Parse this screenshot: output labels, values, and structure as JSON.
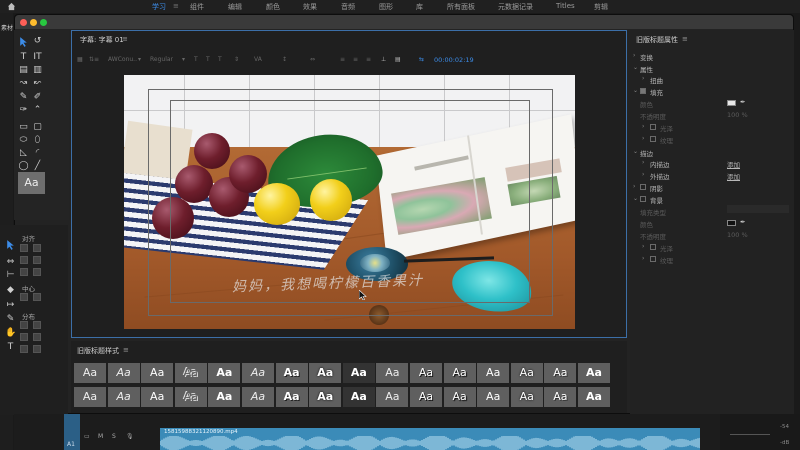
{
  "top_menu": {
    "items": [
      "学习",
      "组件",
      "编辑",
      "颜色",
      "效果",
      "音频",
      "图形",
      "库",
      "所有面板",
      "元数据记录",
      "Titles",
      "剪辑"
    ],
    "active": "学习"
  },
  "app_rail_label": "素材",
  "title_panel": {
    "tab_title": "字幕: 字幕 01",
    "toolbar": {
      "font_family": "AWConu..",
      "font_style": "Regular",
      "timecode": "00:00:02:19"
    },
    "caption_text": "妈妈，我想喝柠檬百香果汁"
  },
  "align_panel": {
    "title": "对齐",
    "center_label": "中心",
    "distribute_label": "分布"
  },
  "styles_panel": {
    "title": "旧版标题样式",
    "swatch_label": "Aa",
    "swatch_count": 32
  },
  "properties_panel": {
    "title": "旧版标题属性",
    "rows": [
      {
        "text": "变换",
        "kind": "section"
      },
      {
        "text": "属性",
        "kind": "section"
      },
      {
        "text": "扭曲",
        "kind": "sub"
      },
      {
        "text": "填充",
        "kind": "check-section"
      },
      {
        "text": "颜色",
        "kind": "dim"
      },
      {
        "text": "不透明度",
        "kind": "dim"
      },
      {
        "text": "光泽",
        "kind": "dim-check"
      },
      {
        "text": "纹理",
        "kind": "dim-check"
      },
      {
        "text": "描边",
        "kind": "section"
      },
      {
        "text": "内描边",
        "kind": "sub"
      },
      {
        "text": "外描边",
        "kind": "sub"
      },
      {
        "text": "阴影",
        "kind": "check-section"
      },
      {
        "text": "背景",
        "kind": "check-section"
      },
      {
        "text": "填充类型",
        "kind": "dim"
      },
      {
        "text": "颜色",
        "kind": "dim"
      },
      {
        "text": "不透明度",
        "kind": "dim"
      },
      {
        "text": "光泽",
        "kind": "dim-check"
      },
      {
        "text": "纹理",
        "kind": "dim-check"
      }
    ],
    "add_link": "添加",
    "opacity_fill": "100 %",
    "opacity_bg": "100 %",
    "fill_color": "#e8e8e8",
    "bg_color": "#111111"
  },
  "timeline": {
    "clip_name": "15815988321120890.mp4",
    "track_label": "A1",
    "track_buttons": [
      "M",
      "S"
    ],
    "meter_labels": [
      "-54",
      "-dB"
    ]
  },
  "colors": {
    "accent": "#3c8ce8",
    "panel_bg": "#1f1f1f",
    "audio_clip": "#3b8bb8"
  }
}
